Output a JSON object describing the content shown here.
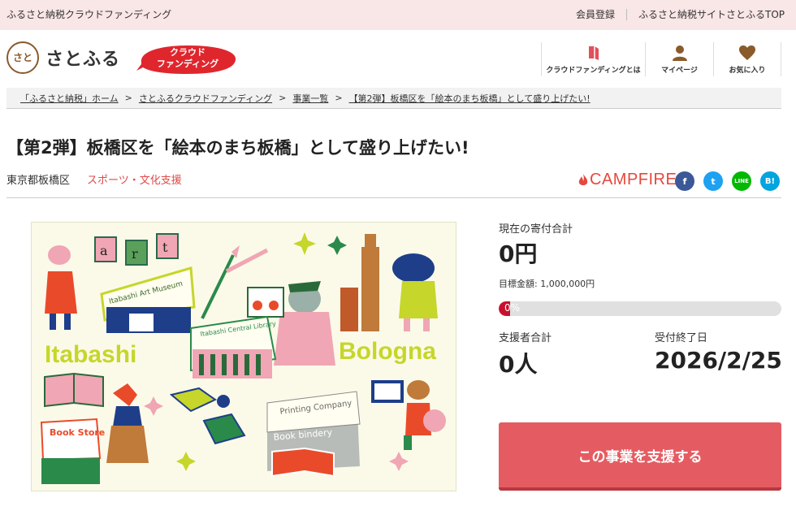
{
  "topbar": {
    "site_name": "ふるさと納税クラウドファンディング",
    "links": [
      "会員登録",
      "ふるさと納税サイトさとふるTOP"
    ]
  },
  "header": {
    "logo_mark": "さと",
    "logo_text": "さとふる",
    "badge_line1": "クラウド",
    "badge_line2": "ファンディング",
    "nav": [
      {
        "label": "クラウドファンディングとは",
        "icon": "book-icon"
      },
      {
        "label": "マイページ",
        "icon": "user-icon"
      },
      {
        "label": "お気に入り",
        "icon": "heart-icon"
      }
    ]
  },
  "breadcrumb": [
    "「ふるさと納税」ホーム",
    "さとふるクラウドファンディング",
    "事業一覧",
    "【第2弾】板橋区を「絵本のまち板橋」として盛り上げたい!"
  ],
  "project": {
    "title": "【第2弾】板橋区を「絵本のまち板橋」として盛り上げたい!",
    "region": "東京都板橋区",
    "category": "スポーツ・文化支援",
    "partner": "CAMPFIRE"
  },
  "shares": [
    {
      "name": "facebook-icon",
      "glyph": "f",
      "color": "#3b5998"
    },
    {
      "name": "twitter-icon",
      "glyph": "t",
      "color": "#1da1f2"
    },
    {
      "name": "line-icon",
      "glyph": "LINE",
      "color": "#00b900"
    },
    {
      "name": "hatena-icon",
      "glyph": "B!",
      "color": "#00a4de"
    }
  ],
  "hero": {
    "texts": [
      "Itabashi",
      "Bologna",
      "Itabashi Art Museum",
      "Itabashi Central Library",
      "Printing Company",
      "Book bindery",
      "Book Store"
    ],
    "letters": [
      "a",
      "r",
      "t"
    ]
  },
  "stats": {
    "total_label": "現在の寄付合計",
    "total_value": "0円",
    "goal": "目標金額: 1,000,000円",
    "progress_text": "0%",
    "progress_fraction": 0,
    "supporters_label": "支援者合計",
    "supporters_value": "0人",
    "deadline_label": "受付終了日",
    "deadline_value": "2026/2/25"
  },
  "cta": "この事業を支援する"
}
